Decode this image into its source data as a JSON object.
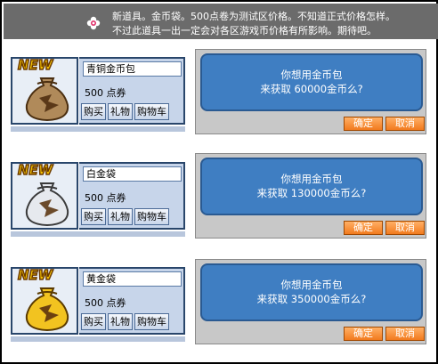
{
  "header": {
    "line1": "新道具。金币袋。500点卷为测试区价格。不知道正式价格怎样。",
    "line2": "不过此道具一出一定会对各区游戏币价格有所影响。期待吧。"
  },
  "items": [
    {
      "new_tag": "NEW",
      "name": "青铜金币包",
      "price": "500 点券",
      "buy": "购买",
      "gift": "礼物",
      "cart": "购物车",
      "dialog_line1": "你想用金币包",
      "dialog_line2": "来获取 60000金币么?",
      "ok": "确定",
      "cancel": "取消",
      "bag_color": "#b08a5a"
    },
    {
      "new_tag": "NEW",
      "name": "白金袋",
      "price": "500 点券",
      "buy": "购买",
      "gift": "礼物",
      "cart": "购物车",
      "dialog_line1": "你想用金币包",
      "dialog_line2": "来获取 130000金币么?",
      "ok": "确定",
      "cancel": "取消",
      "bag_color": "#e6e9ee"
    },
    {
      "new_tag": "NEW",
      "name": "黄金袋",
      "price": "500 点券",
      "buy": "购买",
      "gift": "礼物",
      "cart": "购物车",
      "dialog_line1": "你想用金币包",
      "dialog_line2": "来获取 350000金币么?",
      "ok": "确定",
      "cancel": "取消",
      "bag_color": "#f2c320"
    }
  ],
  "colors": {
    "accent_orange": "#f27a1e",
    "dialog_blue": "#3f7ec2",
    "card_blue": "#c7d5ea"
  }
}
